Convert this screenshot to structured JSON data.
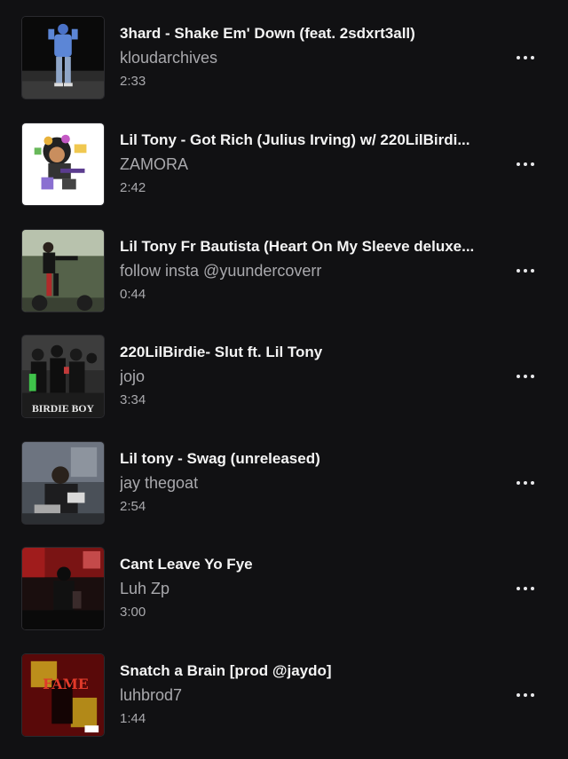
{
  "tracks": [
    {
      "title": "3hard - Shake Em' Down (feat. 2sdxrt3all)",
      "artist": "kloudarchives",
      "duration": "2:33",
      "art": "blue-figure"
    },
    {
      "title": "Lil Tony - Got Rich (Julius Irving) w/ 220LilBirdi...",
      "artist": "ZAMORA",
      "duration": "2:42",
      "art": "cartoon-white"
    },
    {
      "title": "Lil Tony Fr Bautista (Heart On My Sleeve deluxe...",
      "artist": "follow insta @yuundercoverr",
      "duration": "0:44",
      "art": "car-photo"
    },
    {
      "title": "220LilBirdie- Slut ft. Lil Tony",
      "artist": "jojo",
      "duration": "3:34",
      "art": "birdie-boy",
      "art_text": "BIRDIE BOY"
    },
    {
      "title": "Lil tony - Swag (unreleased)",
      "artist": "jay thegoat",
      "duration": "2:54",
      "art": "studio-photo"
    },
    {
      "title": "Cant Leave Yo Fye",
      "artist": "Luh Zp",
      "duration": "3:00",
      "art": "red-room"
    },
    {
      "title": "Snatch a Brain [prod @jaydo]",
      "artist": "luhbrod7",
      "duration": "1:44",
      "art": "red-poster",
      "art_text": "FAME"
    }
  ],
  "more_icon": "more-horizontal-icon"
}
